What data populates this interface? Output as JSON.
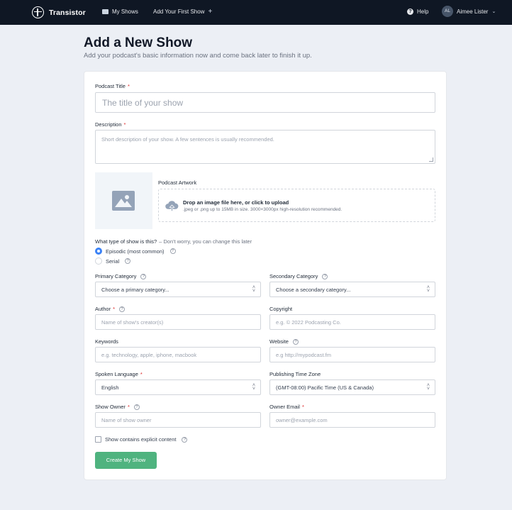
{
  "nav": {
    "brand": "Transistor",
    "my_shows": "My Shows",
    "add_show": "Add Your First Show",
    "help": "Help",
    "user_initials": "AL",
    "user_name": "Aimee Lister"
  },
  "header": {
    "title": "Add a New Show",
    "subtitle": "Add your podcast's basic information now and come back later to finish it up."
  },
  "form": {
    "podcast_title": {
      "label": "Podcast Title",
      "placeholder": "The title of your show"
    },
    "description": {
      "label": "Description",
      "placeholder": "Short description of your show. A few sentences is usually recommended."
    },
    "artwork": {
      "label": "Podcast Artwork",
      "drop_title": "Drop an image file here, or click to upload",
      "drop_sub": ".jpeg or .png up to 15MB in size. 3000×3000px high-resolution recommended."
    },
    "show_type": {
      "question": "What type of show is this?",
      "hint": "– Don't worry, you can change this later",
      "options": [
        "Episodic (most common)",
        "Serial"
      ],
      "selected": "Episodic (most common)"
    },
    "primary_category": {
      "label": "Primary Category",
      "value": "Choose a primary category..."
    },
    "secondary_category": {
      "label": "Secondary Category",
      "value": "Choose a secondary category..."
    },
    "author": {
      "label": "Author",
      "placeholder": "Name of show's creator(s)"
    },
    "copyright": {
      "label": "Copyright",
      "placeholder": "e.g. © 2022 Podcasting Co."
    },
    "keywords": {
      "label": "Keywords",
      "placeholder": "e.g. technology, apple, iphone, macbook"
    },
    "website": {
      "label": "Website",
      "placeholder": "e.g http://mypodcast.fm"
    },
    "spoken_language": {
      "label": "Spoken Language",
      "value": "English"
    },
    "time_zone": {
      "label": "Publishing Time Zone",
      "value": "(GMT-08:00) Pacific Time (US & Canada)"
    },
    "show_owner": {
      "label": "Show Owner",
      "placeholder": "Name of show owner"
    },
    "owner_email": {
      "label": "Owner Email",
      "placeholder": "owner@example.com"
    },
    "explicit": {
      "label": "Show contains explicit content",
      "checked": false
    },
    "submit": "Create My Show"
  },
  "colors": {
    "nav_bg": "#0f1724",
    "accent": "#4fb37f",
    "radio": "#3b82f6",
    "required": "#dc2626"
  }
}
